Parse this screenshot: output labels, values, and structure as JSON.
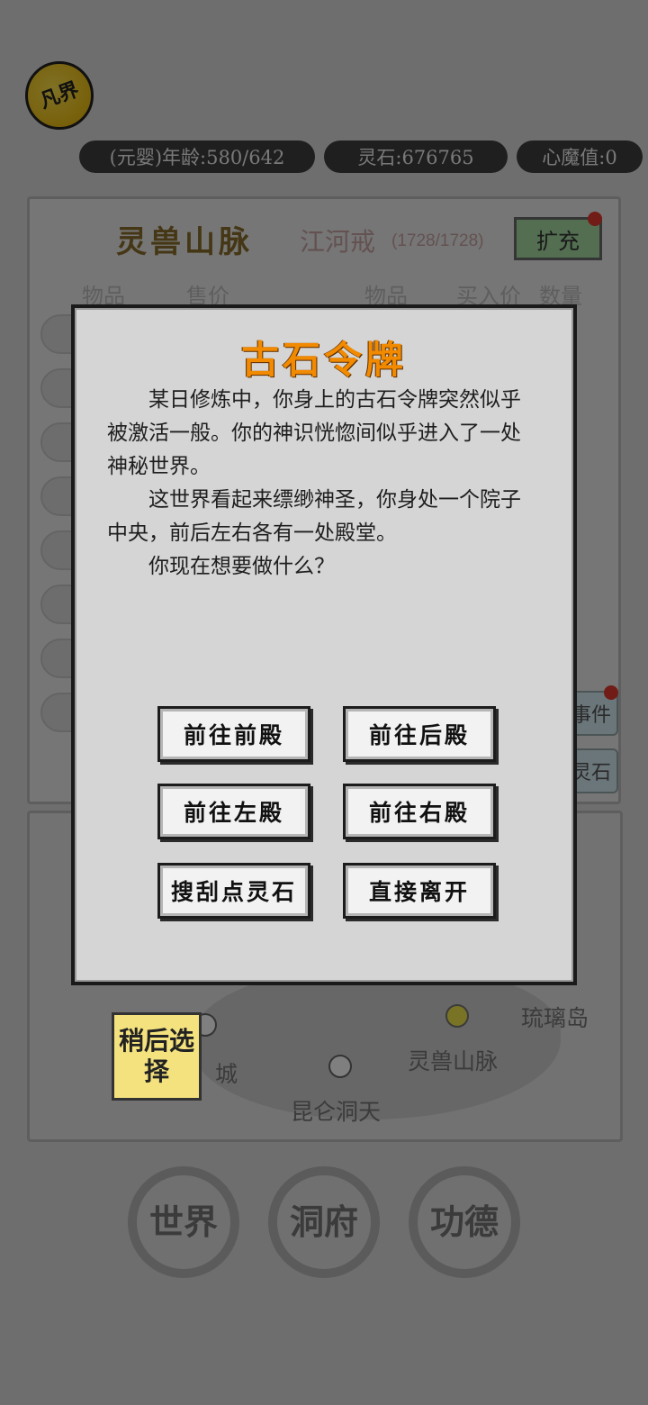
{
  "header": {
    "logo_text": "凡界",
    "age": "(元婴)年龄:580/642",
    "spirit_stones": "灵石:676765",
    "demon_value": "心魔值:0"
  },
  "market": {
    "title": "灵兽山脉",
    "ring_name": "江河戒",
    "ring_capacity": "(1728/1728)",
    "expand_button": "扩充",
    "columns_left": [
      "物品",
      "售价"
    ],
    "columns_right": [
      "物品",
      "买入价",
      "数量"
    ],
    "side_buttons": [
      "事件",
      "灵石"
    ]
  },
  "map": {
    "places": [
      "琉璃岛",
      "灵兽山脉",
      "昆仑洞天",
      "城"
    ]
  },
  "later_button": "稍后选择",
  "bottom_nav": [
    "世界",
    "洞府",
    "功德"
  ],
  "modal": {
    "title": "古石令牌",
    "paragraphs": [
      "某日修炼中，你身上的古石令牌突然似乎被激活一般。你的神识恍惚间似乎进入了一处神秘世界。",
      "这世界看起来缥缈神圣，你身处一个院子中央，前后左右各有一处殿堂。",
      "你现在想要做什么？"
    ],
    "choices": [
      "前往前殿",
      "前往后殿",
      "前往左殿",
      "前往右殿",
      "搜刮点灵石",
      "直接离开"
    ]
  }
}
